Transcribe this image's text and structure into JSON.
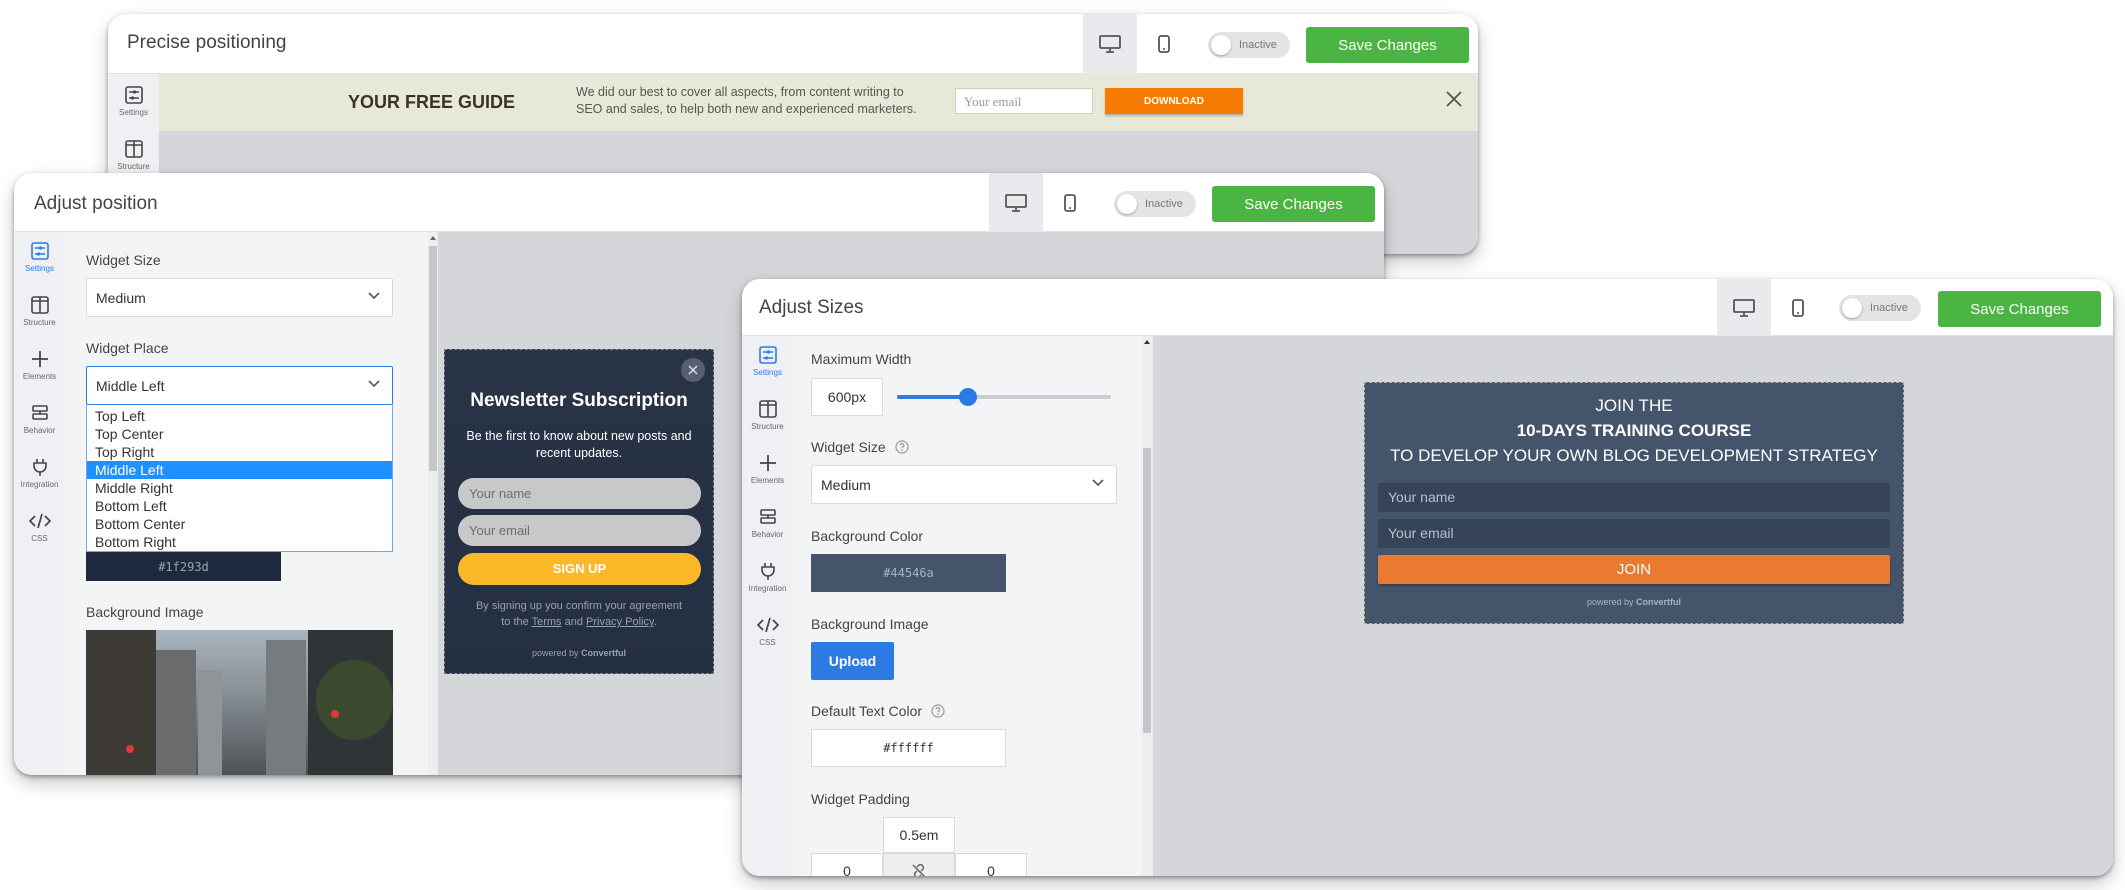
{
  "window1": {
    "title": "Precise positioning",
    "toggle_label": "Inactive",
    "save_label": "Save Changes",
    "sidebar": [
      "Settings",
      "Structure"
    ],
    "bar": {
      "heading": "YOUR FREE GUIDE",
      "text_line1": "We did our best to cover all aspects, from content writing to",
      "text_line2": "SEO and sales, to help both new and experienced marketers.",
      "email_placeholder": "Your email",
      "download_label": "DOWNLOAD"
    }
  },
  "window2": {
    "title": "Adjust position",
    "toggle_label": "Inactive",
    "save_label": "Save Changes",
    "sidebar": [
      "Settings",
      "Structure",
      "Elements",
      "Behavior",
      "Integration",
      "CSS"
    ],
    "widget_size_label": "Widget Size",
    "widget_size_value": "Medium",
    "widget_place_label": "Widget Place",
    "widget_place_value": "Middle Left",
    "place_options": [
      "Top Left",
      "Top Center",
      "Top Right",
      "Middle Left",
      "Middle Right",
      "Bottom Left",
      "Bottom Center",
      "Bottom Right"
    ],
    "selected_option": "Middle Left",
    "color_hex": "#1f293d",
    "bg_image_label": "Background Image",
    "popup": {
      "title": "Newsletter Subscription",
      "subtitle_line1": "Be the first to know about new posts and",
      "subtitle_line2": "recent updates.",
      "name_placeholder": "Your name",
      "email_placeholder": "Your email",
      "button": "SIGN UP",
      "legal_line1": "By signing up you confirm your agreement",
      "legal_to": "to the",
      "legal_terms": "Terms",
      "legal_and": "and",
      "legal_privacy": "Privacy Policy",
      "legal_end": ".",
      "powered_prefix": "powered by",
      "powered_brand": "Convertful"
    }
  },
  "window3": {
    "title": "Adjust Sizes",
    "toggle_label": "Inactive",
    "save_label": "Save Changes",
    "sidebar": [
      "Settings",
      "Structure",
      "Elements",
      "Behavior",
      "Integration",
      "CSS"
    ],
    "max_width_label": "Maximum Width",
    "max_width_value": "600px",
    "slider_fraction": 0.33,
    "widget_size_label": "Widget Size",
    "widget_size_value": "Medium",
    "bg_color_label": "Background Color",
    "bg_color_value": "#44546a",
    "bg_image_label": "Background Image",
    "upload_label": "Upload",
    "text_color_label": "Default Text Color",
    "text_color_value": "#ffffff",
    "padding_label": "Widget Padding",
    "padding_top": "0.5em",
    "padding_left": "0",
    "padding_right": "0",
    "widget": {
      "line1": "JOIN THE",
      "line2": "10-DAYS TRAINING COURSE",
      "line3": "TO DEVELOP YOUR OWN BLOG DEVELOPMENT STRATEGY",
      "name_placeholder": "Your name",
      "email_placeholder": "Your email",
      "button": "JOIN",
      "powered_prefix": "powered by",
      "powered_brand": "Convertful"
    }
  },
  "colors": {
    "save_green": "#4bb543",
    "accent_blue": "#2c7be5",
    "download_orange": "#f57c00",
    "signup_yellow": "#fbb829",
    "join_orange": "#ea7a32",
    "widget_bg": "#44546a",
    "popup_bg": "#1f293d"
  }
}
